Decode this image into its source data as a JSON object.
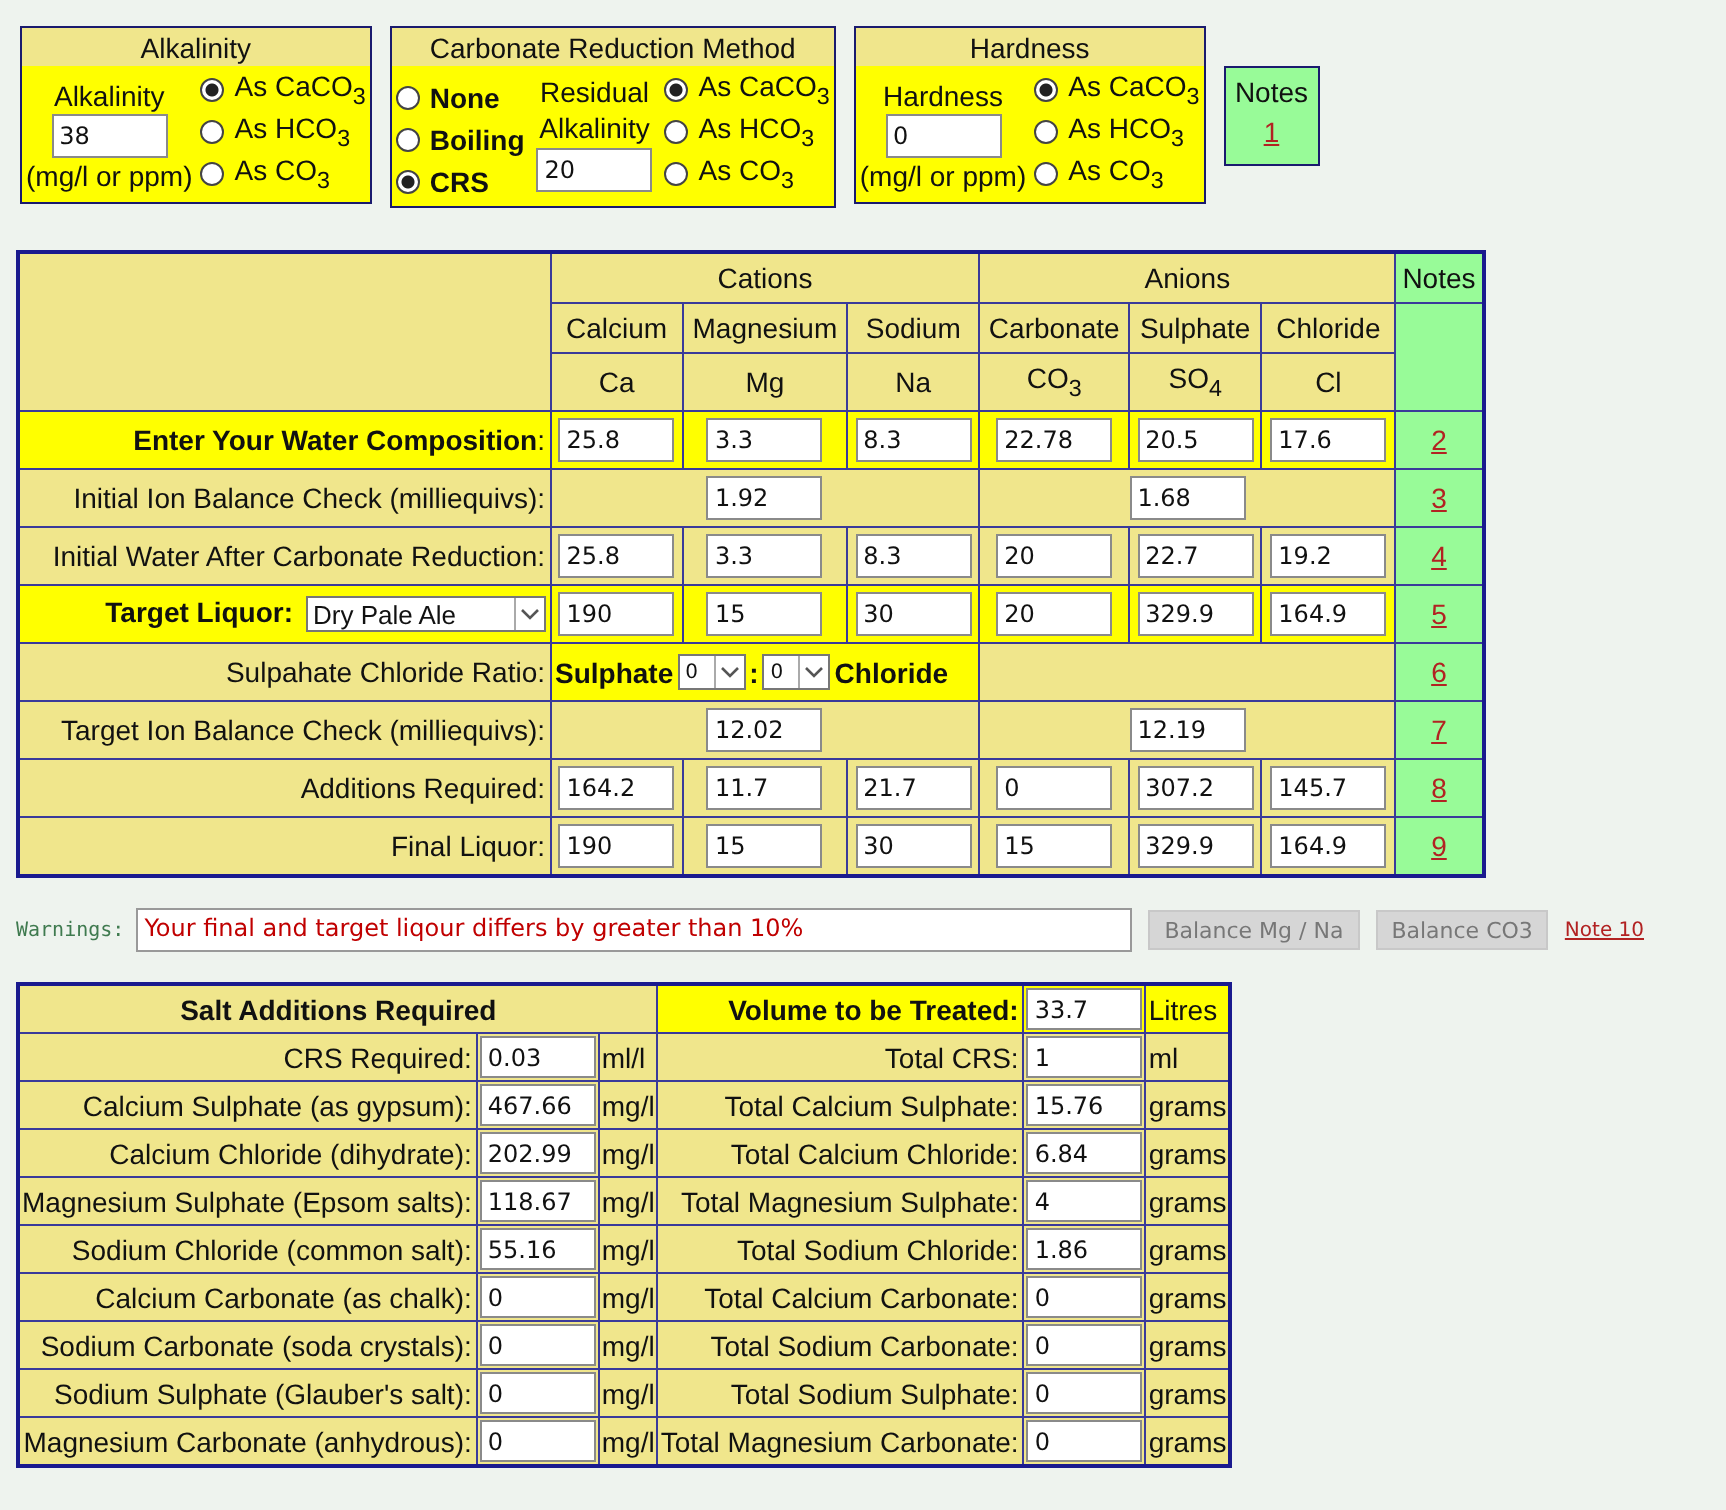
{
  "alkalinity": {
    "title": "Alkalinity",
    "label": "Alkalinity",
    "value": "38",
    "unit": "(mg/l or ppm)",
    "options": [
      {
        "label": "As CaCO$_{3}$",
        "selected": true
      },
      {
        "label": "As HCO$_{3}$",
        "selected": false
      },
      {
        "label": "As CO$_{3}$",
        "selected": false
      }
    ]
  },
  "carbonate_reduction": {
    "title": "Carbonate Reduction Method",
    "methods": [
      {
        "label": "None",
        "selected": false
      },
      {
        "label": "Boiling",
        "selected": false
      },
      {
        "label": "CRS",
        "selected": true
      }
    ],
    "residual_label": "Residual Alkalinity",
    "residual_value": "20",
    "options": [
      {
        "label": "As CaCO$_{3}$",
        "selected": true
      },
      {
        "label": "As HCO$_{3}$",
        "selected": false
      },
      {
        "label": "As CO$_{3}$",
        "selected": false
      }
    ]
  },
  "hardness": {
    "title": "Hardness",
    "label": "Hardness",
    "value": "0",
    "unit": "(mg/l or ppm)",
    "options": [
      {
        "label": "As CaCO$_{3}$",
        "selected": true
      },
      {
        "label": "As HCO$_{3}$",
        "selected": false
      },
      {
        "label": "As CO$_{3}$",
        "selected": false
      }
    ]
  },
  "notes_box": {
    "title": "Notes",
    "link": "1"
  },
  "composition": {
    "groups": [
      "Cations",
      "Anions"
    ],
    "notes_header": "Notes",
    "columns": [
      {
        "name": "Calcium",
        "symbol": "Ca"
      },
      {
        "name": "Magnesium",
        "symbol": "Mg"
      },
      {
        "name": "Sodium",
        "symbol": "Na"
      },
      {
        "name": "Carbonate",
        "symbol": "CO$_{3}$"
      },
      {
        "name": "Sulphate",
        "symbol": "SO$_{4}$"
      },
      {
        "name": "Chloride",
        "symbol": "Cl"
      }
    ],
    "rows": [
      {
        "kind": "values",
        "label": "**Enter Your Water Composition**:",
        "highlighted": true,
        "values": [
          "25.8",
          "3.3",
          "8.3",
          "22.78",
          "20.5",
          "17.6"
        ],
        "note": "2"
      },
      {
        "kind": "balance",
        "label": "Initial Ion Balance Check (milliequivs):",
        "highlighted": false,
        "cations": "1.92",
        "anions": "1.68",
        "note": "3"
      },
      {
        "kind": "values",
        "label": "Initial Water After Carbonate Reduction:",
        "highlighted": false,
        "values": [
          "25.8",
          "3.3",
          "8.3",
          "20",
          "22.7",
          "19.2"
        ],
        "note": "4"
      },
      {
        "kind": "target",
        "label": "Target Liquor:",
        "highlighted": true,
        "style": "Dry Pale Ale",
        "values": [
          "190",
          "15",
          "30",
          "20",
          "329.9",
          "164.9"
        ],
        "note": "5"
      },
      {
        "kind": "ratio",
        "label": "Sulpahate Chloride Ratio:",
        "highlighted": false,
        "left_label": "Sulphate",
        "left_value": "0",
        "separator": ":",
        "right_value": "0",
        "right_label": "Chloride",
        "note": "6"
      },
      {
        "kind": "balance",
        "label": "Target Ion Balance Check (milliequivs):",
        "highlighted": false,
        "cations": "12.02",
        "anions": "12.19",
        "note": "7"
      },
      {
        "kind": "values",
        "label": "Additions Required:",
        "highlighted": false,
        "values": [
          "164.2",
          "11.7",
          "21.7",
          "0",
          "307.2",
          "145.7"
        ],
        "note": "8"
      },
      {
        "kind": "values",
        "label": "Final Liquor:",
        "highlighted": false,
        "values": [
          "190",
          "15",
          "30",
          "15",
          "329.9",
          "164.9"
        ],
        "note": "9"
      }
    ]
  },
  "warnings": {
    "label": "Warnings:",
    "message": "Your final and target liqour differs by greater than 10%",
    "buttons": [
      {
        "label": "Balance Mg / Na",
        "disabled": true
      },
      {
        "label": "Balance CO3",
        "disabled": true
      }
    ],
    "note_link": "Note 10"
  },
  "salts": {
    "header": "Salt Additions Required",
    "volume_label": "Volume to be Treated:",
    "volume": "33.7",
    "volume_unit": "Litres",
    "rows": [
      {
        "label": "CRS Required:",
        "value": "0.03",
        "unit": "ml/l",
        "total_label": "Total CRS:",
        "total": "1",
        "total_unit": "ml"
      },
      {
        "label": "Calcium Sulphate (as gypsum):",
        "value": "467.66",
        "unit": "mg/l",
        "total_label": "Total Calcium Sulphate:",
        "total": "15.76",
        "total_unit": "grams"
      },
      {
        "label": "Calcium Chloride (dihydrate):",
        "value": "202.99",
        "unit": "mg/l",
        "total_label": "Total Calcium Chloride:",
        "total": "6.84",
        "total_unit": "grams"
      },
      {
        "label": "Magnesium Sulphate (Epsom salts):",
        "value": "118.67",
        "unit": "mg/l",
        "total_label": "Total Magnesium Sulphate:",
        "total": "4",
        "total_unit": "grams"
      },
      {
        "label": "Sodium Chloride (common salt):",
        "value": "55.16",
        "unit": "mg/l",
        "total_label": "Total Sodium Chloride:",
        "total": "1.86",
        "total_unit": "grams"
      },
      {
        "label": "Calcium Carbonate (as chalk):",
        "value": "0",
        "unit": "mg/l",
        "total_label": "Total Calcium Carbonate:",
        "total": "0",
        "total_unit": "grams"
      },
      {
        "label": "Sodium Carbonate (soda crystals):",
        "value": "0",
        "unit": "mg/l",
        "total_label": "Total Sodium Carbonate:",
        "total": "0",
        "total_unit": "grams"
      },
      {
        "label": "Sodium Sulphate (Glauber's salt):",
        "value": "0",
        "unit": "mg/l",
        "total_label": "Total Sodium Sulphate:",
        "total": "0",
        "total_unit": "grams"
      },
      {
        "label": "Magnesium Carbonate (anhydrous):",
        "value": "0",
        "unit": "mg/l",
        "total_label": "Total Magnesium Carbonate:",
        "total": "0",
        "total_unit": "grams"
      }
    ]
  }
}
